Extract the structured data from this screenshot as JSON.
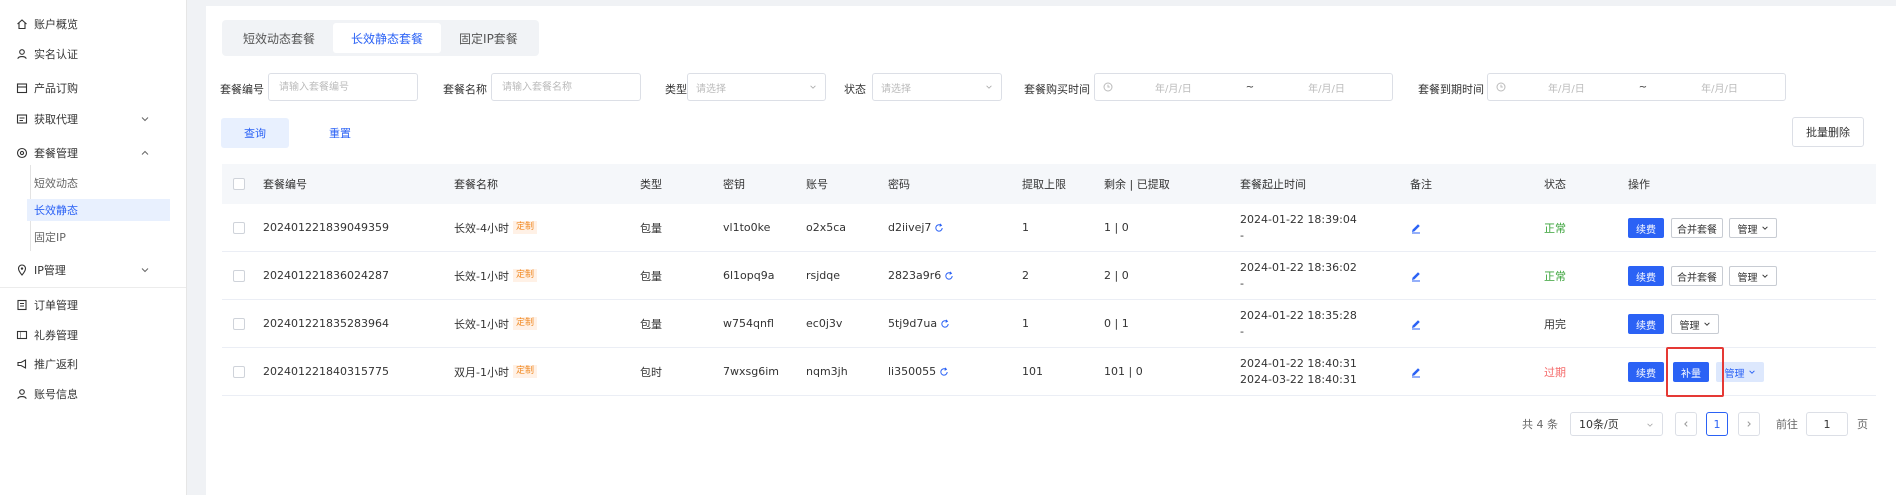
{
  "sidebar": {
    "items": [
      {
        "label": "账户概览",
        "icon": "home-icon"
      },
      {
        "label": "实名认证",
        "icon": "user-check-icon"
      },
      {
        "label": "产品订购",
        "icon": "cart-icon"
      },
      {
        "label": "获取代理",
        "icon": "proxy-icon"
      },
      {
        "label": "套餐管理",
        "icon": "package-icon"
      },
      {
        "label": "IP管理",
        "icon": "location-icon"
      },
      {
        "label": "订单管理",
        "icon": "order-icon"
      },
      {
        "label": "礼券管理",
        "icon": "coupon-icon"
      },
      {
        "label": "推广返利",
        "icon": "promo-icon"
      },
      {
        "label": "账号信息",
        "icon": "account-icon"
      }
    ],
    "subitems": [
      "短效动态",
      "长效静态",
      "固定IP"
    ],
    "active_sub": "长效静态"
  },
  "tabs": [
    "短效动态套餐",
    "长效静态套餐",
    "固定IP套餐"
  ],
  "active_tab": "长效静态套餐",
  "filters": {
    "package_no": {
      "label": "套餐编号",
      "placeholder": "请输入套餐编号"
    },
    "package_name": {
      "label": "套餐名称",
      "placeholder": "请输入套餐名称"
    },
    "type": {
      "label": "类型",
      "placeholder": "请选择"
    },
    "status": {
      "label": "状态",
      "placeholder": "请选择"
    },
    "purchase_time": {
      "label": "套餐购买时间",
      "start": "年/月/日",
      "sep": "~",
      "end": "年/月/日"
    },
    "expire_time": {
      "label": "套餐到期时间",
      "start": "年/月/日",
      "sep": "~",
      "end": "年/月/日"
    }
  },
  "buttons": {
    "query": "查询",
    "reset": "重置",
    "bulk_delete": "批量删除"
  },
  "table": {
    "headers": [
      "套餐编号",
      "套餐名称",
      "类型",
      "密钥",
      "账号",
      "密码",
      "提取上限",
      "剩余 | 已提取",
      "套餐起止时间",
      "备注",
      "状态",
      "操作"
    ],
    "custom_tag": "定制",
    "rows": [
      {
        "no": "202401221839049359",
        "name": "长效-4小时",
        "type": "包量",
        "key": "vl1to0ke",
        "account": "o2x5ca",
        "password": "d2iivej7",
        "limit": "1",
        "remain": "1 | 0",
        "time1": "2024-01-22 18:39:04",
        "time2": "-",
        "status": "正常",
        "status_color": "#3aa33a"
      },
      {
        "no": "202401221836024287",
        "name": "长效-1小时",
        "type": "包量",
        "key": "6l1opq9a",
        "account": "rsjdqe",
        "password": "2823a9r6",
        "limit": "2",
        "remain": "2 | 0",
        "time1": "2024-01-22 18:36:02",
        "time2": "-",
        "status": "正常",
        "status_color": "#3aa33a"
      },
      {
        "no": "202401221835283964",
        "name": "长效-1小时",
        "type": "包量",
        "key": "w754qnfl",
        "account": "ec0j3v",
        "password": "5tj9d7ua",
        "limit": "1",
        "remain": "0 | 1",
        "time1": "2024-01-22 18:35:28",
        "time2": "-",
        "status": "用完",
        "status_color": "#333333"
      },
      {
        "no": "202401221840315775",
        "name": "双月-1小时",
        "type": "包时",
        "key": "7wxsg6im",
        "account": "nqm3jh",
        "password": "li350055",
        "limit": "101",
        "remain": "101 | 0",
        "time1": "2024-01-22 18:40:31",
        "time2": "2024-03-22 18:40:31",
        "status": "过期",
        "status_color": "#f56c6c"
      }
    ],
    "actions": {
      "renew": "续费",
      "merge": "合并套餐",
      "manage": "管理",
      "topup": "补量"
    }
  },
  "pagination": {
    "total": "共 4 条",
    "page_size": "10条/页",
    "current": "1",
    "goto_label": "前往",
    "goto_value": "1",
    "page_unit": "页"
  }
}
